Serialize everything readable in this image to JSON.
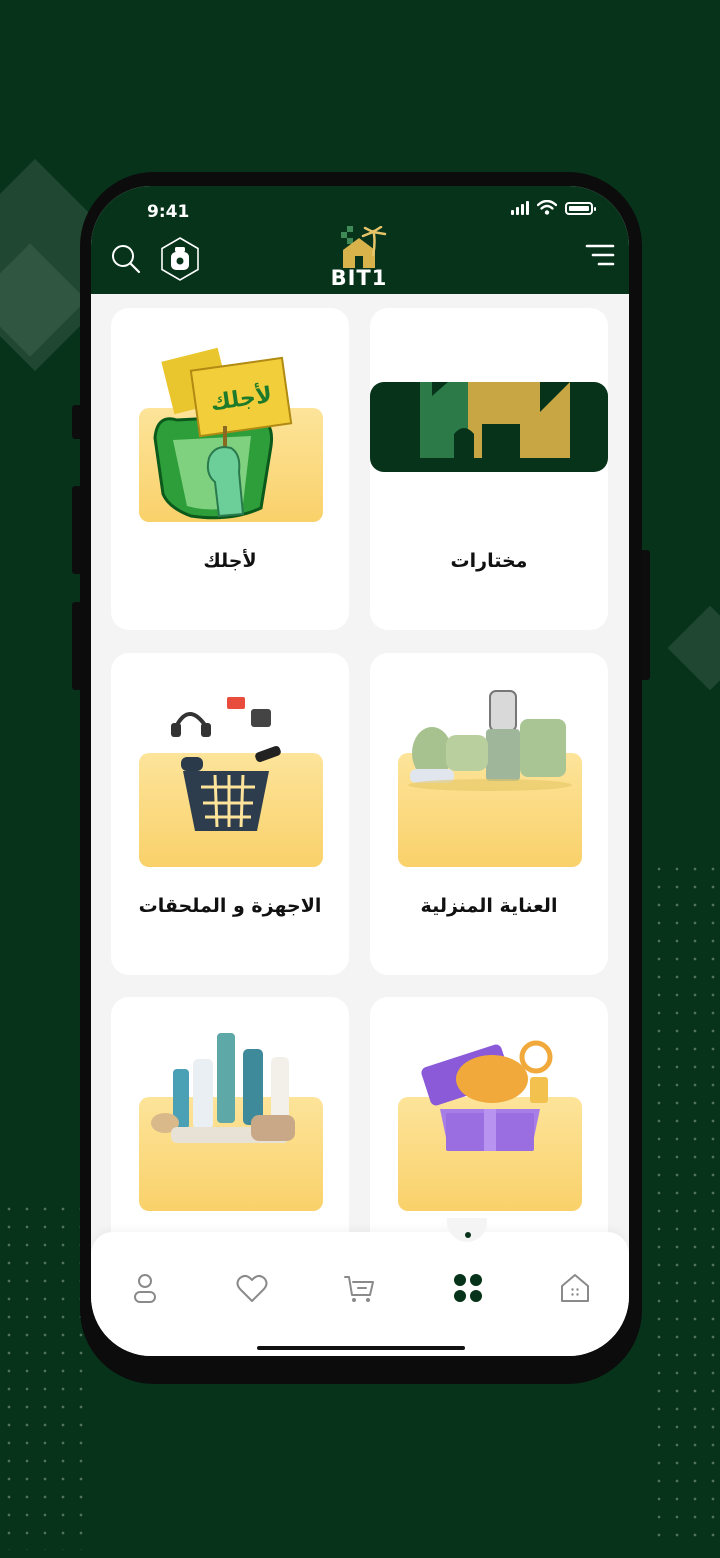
{
  "status_bar": {
    "time": "9:41"
  },
  "header": {
    "logo_text": "BIT1",
    "search_icon": "search-icon",
    "badge_icon": "hexagon-badge-icon",
    "menu_icon": "menu-icon"
  },
  "categories": [
    {
      "label": "مختارات",
      "icon": "house-logo-banner"
    },
    {
      "label": "لأجلك",
      "icon": "hand-sign-lajlek"
    },
    {
      "label": "العناية المنزلية",
      "icon": "kitchen-appliances"
    },
    {
      "label": "الاجهزة و الملحقات",
      "icon": "electronics-basket"
    },
    {
      "label": "",
      "icon": "gaming-gift-box"
    },
    {
      "label": "",
      "icon": "cosmetics-products"
    }
  ],
  "sign_text": "لأجلك",
  "bottom_nav": {
    "items": [
      {
        "name": "profile",
        "icon": "user-icon"
      },
      {
        "name": "favorites",
        "icon": "heart-icon"
      },
      {
        "name": "cart",
        "icon": "cart-icon"
      },
      {
        "name": "categories",
        "icon": "grid-icon",
        "active": true
      },
      {
        "name": "home",
        "icon": "home-icon"
      }
    ]
  },
  "colors": {
    "brand_green": "#06331a",
    "accent_gold": "#f9d16a",
    "background": "#f4f4f4"
  }
}
